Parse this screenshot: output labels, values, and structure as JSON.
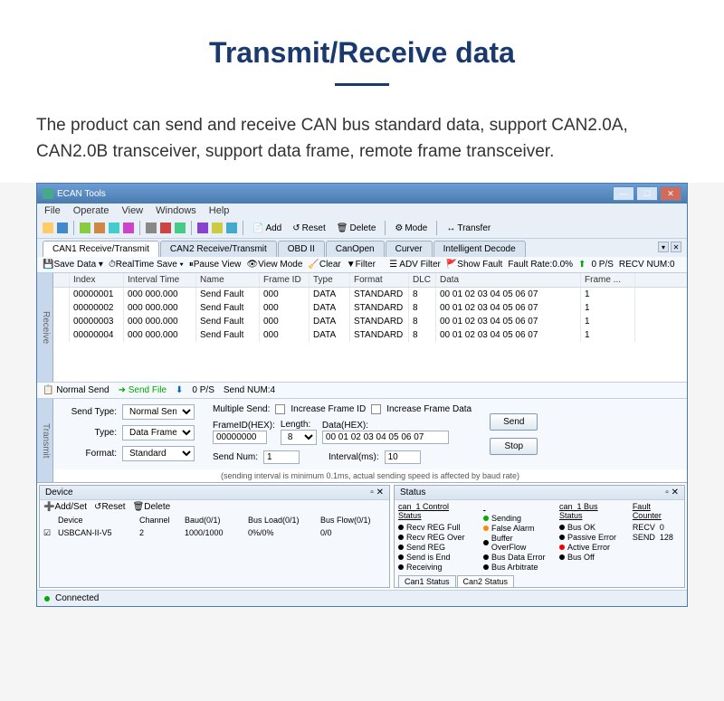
{
  "hero": {
    "title": "Transmit/Receive data",
    "desc": "The product can send and receive CAN bus standard data, support CAN2.0A, CAN2.0B transceiver, support data frame, remote frame transceiver."
  },
  "window": {
    "title": "ECAN Tools"
  },
  "menu": [
    "File",
    "Operate",
    "View",
    "Windows",
    "Help"
  ],
  "toolbar2": {
    "add": "Add",
    "reset": "Reset",
    "delete": "Delete",
    "mode": "Mode",
    "transfer": "Transfer"
  },
  "tabs": [
    "CAN1 Receive/Transmit",
    "CAN2 Receive/Transmit",
    "OBD II",
    "CanOpen",
    "Curver",
    "Intelligent Decode"
  ],
  "subtb": {
    "save": "Save Data",
    "realtime": "RealTime Save",
    "pause": "Pause View",
    "viewmode": "View Mode",
    "clear": "Clear",
    "filter": "Filter",
    "adv": "ADV Filter",
    "fault": "Show Fault",
    "rate": "Fault Rate:0.0%",
    "ps": "0 P/S",
    "recv": "RECV NUM:0"
  },
  "gridcols": [
    "Index",
    "Interval Time",
    "Name",
    "Frame ID",
    "Type",
    "Format",
    "DLC",
    "Data",
    "Frame ..."
  ],
  "rows": [
    {
      "idx": "00000001",
      "int": "000 000.000",
      "nm": "Send Fault",
      "fid": "000",
      "typ": "DATA",
      "fmt": "STANDARD",
      "dlc": "8",
      "dat": "00 01 02 03 04 05 06 07",
      "fr": "1"
    },
    {
      "idx": "00000002",
      "int": "000 000.000",
      "nm": "Send Fault",
      "fid": "000",
      "typ": "DATA",
      "fmt": "STANDARD",
      "dlc": "8",
      "dat": "00 01 02 03 04 05 06 07",
      "fr": "1"
    },
    {
      "idx": "00000003",
      "int": "000 000.000",
      "nm": "Send Fault",
      "fid": "000",
      "typ": "DATA",
      "fmt": "STANDARD",
      "dlc": "8",
      "dat": "00 01 02 03 04 05 06 07",
      "fr": "1"
    },
    {
      "idx": "00000004",
      "int": "000 000.000",
      "nm": "Send Fault",
      "fid": "000",
      "typ": "DATA",
      "fmt": "STANDARD",
      "dlc": "8",
      "dat": "00 01 02 03 04 05 06 07",
      "fr": "1"
    }
  ],
  "ctrl": {
    "normal": "Normal Send",
    "sendfile": "Send File",
    "ps": "0 P/S",
    "sendnum": "Send NUM:4"
  },
  "tx": {
    "sendtype_l": "Send Type:",
    "sendtype_v": "Normal Send",
    "type_l": "Type:",
    "type_v": "Data Frame",
    "format_l": "Format:",
    "format_v": "Standard",
    "multi": "Multiple Send:",
    "inc_id": "Increase Frame ID",
    "inc_data": "Increase Frame Data",
    "fid_l": "FrameID(HEX):",
    "fid_v": "00000000",
    "len_l": "Length:",
    "len_v": "8",
    "data_l": "Data(HEX):",
    "data_v": "00 01 02 03 04 05 06 07",
    "num_l": "Send Num:",
    "num_v": "1",
    "int_l": "Interval(ms):",
    "int_v": "10",
    "send": "Send",
    "stop": "Stop",
    "note": "(sending interval is minimum 0.1ms, actual sending speed is affected by baud rate)"
  },
  "device": {
    "title": "Device",
    "add": "Add/Set",
    "reset": "Reset",
    "delete": "Delete",
    "cols": [
      "Device",
      "Channel",
      "Baud(0/1)",
      "Bus Load(0/1)",
      "Bus Flow(0/1)"
    ],
    "row": {
      "dev": "USBCAN-II-V5",
      "ch": "2",
      "baud": "1000/1000",
      "load": "0%/0%",
      "flow": "0/0"
    }
  },
  "status": {
    "title": "Status",
    "ctrl_h": "can_1 Control Status",
    "ctrl": [
      "Recv REG Full",
      "Recv REG Over",
      "Send REG",
      "Send is End",
      "Receiving",
      "Sending",
      "False Alarm",
      "Buffer OverFlow",
      "Bus Data Error",
      "Bus Arbitrate"
    ],
    "bus_h": "can_1 Bus Status",
    "bus": [
      "Bus OK",
      "Passive Error",
      "Active Error",
      "Bus Off"
    ],
    "fc_h": "Fault Counter",
    "fc_recv": "RECV",
    "fc_recv_v": "0",
    "fc_send": "SEND",
    "fc_send_v": "128",
    "tab1": "Can1 Status",
    "tab2": "Can2 Status"
  },
  "statusbar": {
    "connected": "Connected"
  }
}
